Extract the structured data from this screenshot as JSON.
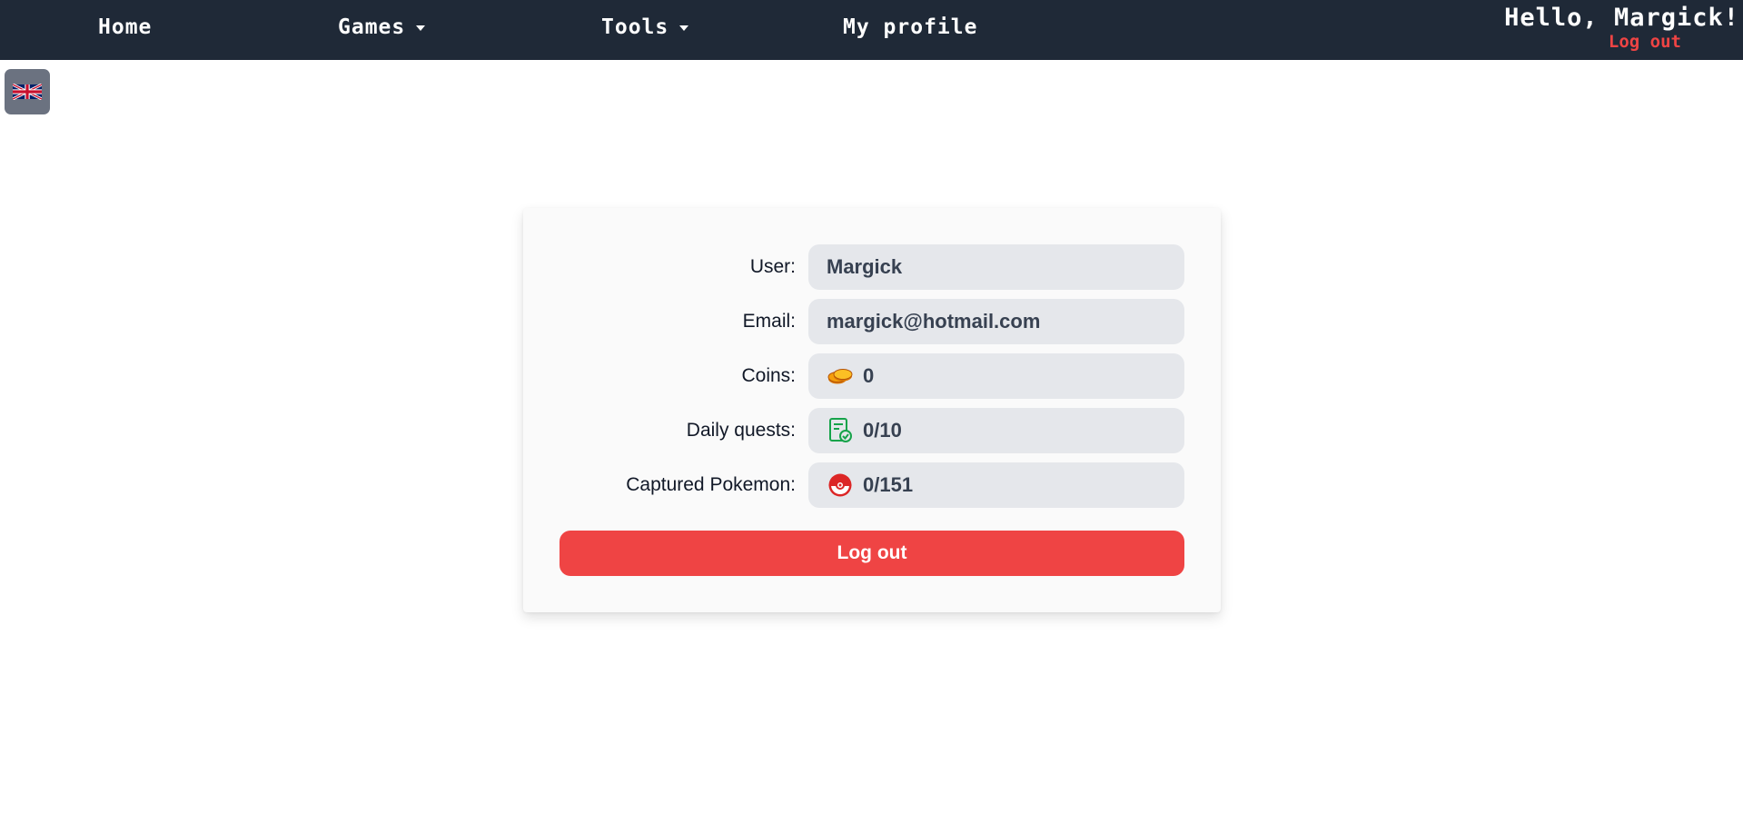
{
  "nav": {
    "home": "Home",
    "games": "Games",
    "tools": "Tools",
    "profile": "My profile",
    "greeting": "Hello, Margick!",
    "logout": "Log out"
  },
  "language": {
    "icon": "uk-flag-icon"
  },
  "profile": {
    "user_label": "User:",
    "user_value": "Margick",
    "email_label": "Email:",
    "email_value": "margick@hotmail.com",
    "coins_label": "Coins:",
    "coins_value": "0",
    "coins_icon": "coins-icon",
    "quests_label": "Daily quests:",
    "quests_value": "0/10",
    "quests_icon": "quest-list-icon",
    "pokemon_label": "Captured Pokemon:",
    "pokemon_value": "0/151",
    "pokemon_icon": "pokeball-icon",
    "logout_button": "Log out"
  },
  "colors": {
    "navbar": "#1f2937",
    "accent_red": "#ef4444",
    "field_bg": "#e5e7eb",
    "coin": "#d97706",
    "quest": "#16a34a",
    "pokeball": "#dc2626"
  }
}
